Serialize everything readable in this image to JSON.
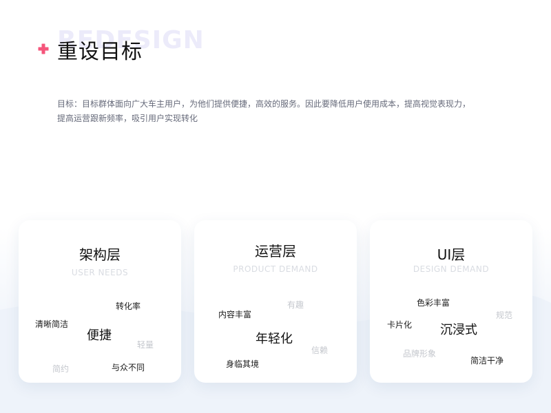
{
  "header": {
    "watermark": "REDESIGN",
    "title": "重设目标",
    "accent_color": "#f5557b",
    "icon": "plus-icon"
  },
  "description": "目标：目标群体面向广大车主用户，为他们提供便捷，高效的服务。因此要降低用户使用成本，提高视觉表现力，提高运营跟新频率，吸引用户实现转化",
  "cards": [
    {
      "title": "架构层",
      "subtitle": "USER NEEDS",
      "tags": {
        "conversion": "转化率",
        "clear": "清晰简洁",
        "convenient": "便捷",
        "light": "轻量",
        "simple": "简约",
        "unique": "与众不同"
      }
    },
    {
      "title": "运营层",
      "subtitle": "PRODUCT DEMAND",
      "tags": {
        "fun": "有趣",
        "rich_content": "内容丰富",
        "younger": "年轻化",
        "trust": "信赖",
        "immersive": "身临其境"
      }
    },
    {
      "title": "UI层",
      "subtitle": "DESIGN DEMAND",
      "tags": {
        "colorful": "色彩丰富",
        "guideline": "规范",
        "card": "卡片化",
        "immersive": "沉浸式",
        "brand": "品牌形象",
        "clean": "简洁干净"
      }
    }
  ]
}
